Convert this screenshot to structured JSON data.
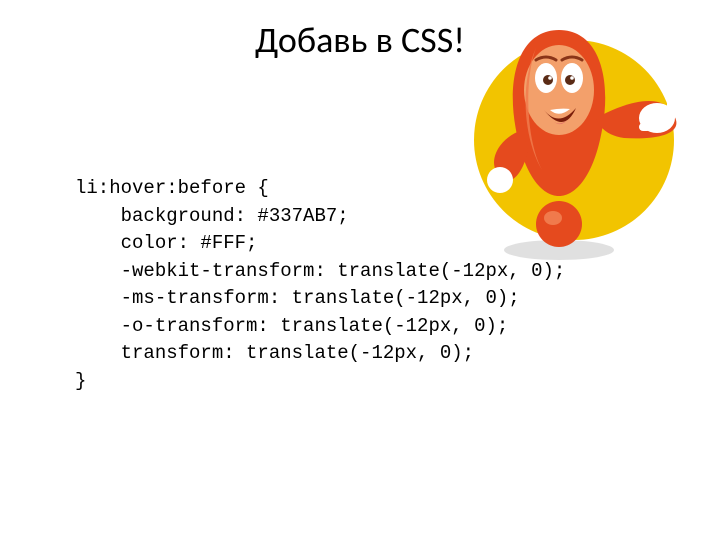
{
  "title": "Добавь в CSS!",
  "code": "li:hover:before {\n    background: #337AB7;\n    color: #FFF;\n    -webkit-transform: translate(-12px, 0);\n    -ms-transform: translate(-12px, 0);\n    -o-transform: translate(-12px, 0);\n    transform: translate(-12px, 0);\n}"
}
